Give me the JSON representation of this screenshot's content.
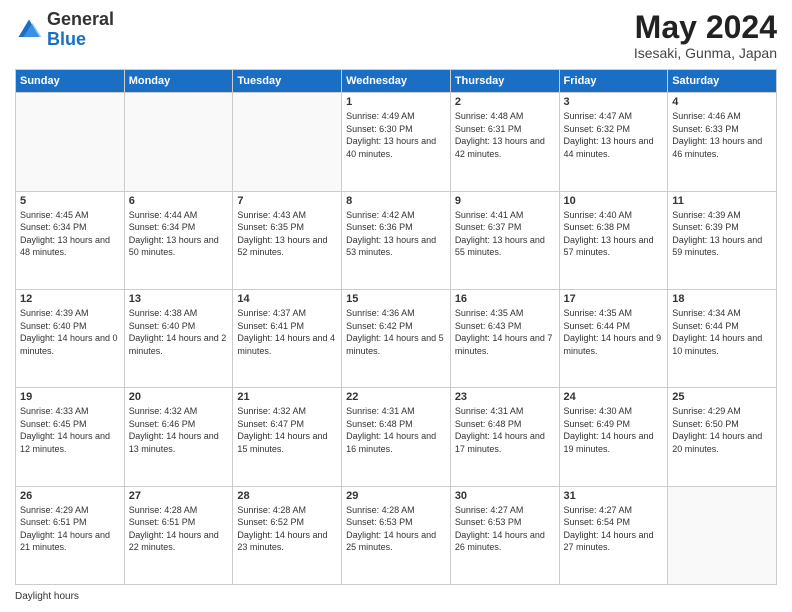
{
  "header": {
    "logo_general": "General",
    "logo_blue": "Blue",
    "month_title": "May 2024",
    "location": "Isesaki, Gunma, Japan"
  },
  "days_of_week": [
    "Sunday",
    "Monday",
    "Tuesday",
    "Wednesday",
    "Thursday",
    "Friday",
    "Saturday"
  ],
  "weeks": [
    [
      {
        "day": "",
        "sunrise": "",
        "sunset": "",
        "daylight": ""
      },
      {
        "day": "",
        "sunrise": "",
        "sunset": "",
        "daylight": ""
      },
      {
        "day": "",
        "sunrise": "",
        "sunset": "",
        "daylight": ""
      },
      {
        "day": "1",
        "sunrise": "Sunrise: 4:49 AM",
        "sunset": "Sunset: 6:30 PM",
        "daylight": "Daylight: 13 hours and 40 minutes."
      },
      {
        "day": "2",
        "sunrise": "Sunrise: 4:48 AM",
        "sunset": "Sunset: 6:31 PM",
        "daylight": "Daylight: 13 hours and 42 minutes."
      },
      {
        "day": "3",
        "sunrise": "Sunrise: 4:47 AM",
        "sunset": "Sunset: 6:32 PM",
        "daylight": "Daylight: 13 hours and 44 minutes."
      },
      {
        "day": "4",
        "sunrise": "Sunrise: 4:46 AM",
        "sunset": "Sunset: 6:33 PM",
        "daylight": "Daylight: 13 hours and 46 minutes."
      }
    ],
    [
      {
        "day": "5",
        "sunrise": "Sunrise: 4:45 AM",
        "sunset": "Sunset: 6:34 PM",
        "daylight": "Daylight: 13 hours and 48 minutes."
      },
      {
        "day": "6",
        "sunrise": "Sunrise: 4:44 AM",
        "sunset": "Sunset: 6:34 PM",
        "daylight": "Daylight: 13 hours and 50 minutes."
      },
      {
        "day": "7",
        "sunrise": "Sunrise: 4:43 AM",
        "sunset": "Sunset: 6:35 PM",
        "daylight": "Daylight: 13 hours and 52 minutes."
      },
      {
        "day": "8",
        "sunrise": "Sunrise: 4:42 AM",
        "sunset": "Sunset: 6:36 PM",
        "daylight": "Daylight: 13 hours and 53 minutes."
      },
      {
        "day": "9",
        "sunrise": "Sunrise: 4:41 AM",
        "sunset": "Sunset: 6:37 PM",
        "daylight": "Daylight: 13 hours and 55 minutes."
      },
      {
        "day": "10",
        "sunrise": "Sunrise: 4:40 AM",
        "sunset": "Sunset: 6:38 PM",
        "daylight": "Daylight: 13 hours and 57 minutes."
      },
      {
        "day": "11",
        "sunrise": "Sunrise: 4:39 AM",
        "sunset": "Sunset: 6:39 PM",
        "daylight": "Daylight: 13 hours and 59 minutes."
      }
    ],
    [
      {
        "day": "12",
        "sunrise": "Sunrise: 4:39 AM",
        "sunset": "Sunset: 6:40 PM",
        "daylight": "Daylight: 14 hours and 0 minutes."
      },
      {
        "day": "13",
        "sunrise": "Sunrise: 4:38 AM",
        "sunset": "Sunset: 6:40 PM",
        "daylight": "Daylight: 14 hours and 2 minutes."
      },
      {
        "day": "14",
        "sunrise": "Sunrise: 4:37 AM",
        "sunset": "Sunset: 6:41 PM",
        "daylight": "Daylight: 14 hours and 4 minutes."
      },
      {
        "day": "15",
        "sunrise": "Sunrise: 4:36 AM",
        "sunset": "Sunset: 6:42 PM",
        "daylight": "Daylight: 14 hours and 5 minutes."
      },
      {
        "day": "16",
        "sunrise": "Sunrise: 4:35 AM",
        "sunset": "Sunset: 6:43 PM",
        "daylight": "Daylight: 14 hours and 7 minutes."
      },
      {
        "day": "17",
        "sunrise": "Sunrise: 4:35 AM",
        "sunset": "Sunset: 6:44 PM",
        "daylight": "Daylight: 14 hours and 9 minutes."
      },
      {
        "day": "18",
        "sunrise": "Sunrise: 4:34 AM",
        "sunset": "Sunset: 6:44 PM",
        "daylight": "Daylight: 14 hours and 10 minutes."
      }
    ],
    [
      {
        "day": "19",
        "sunrise": "Sunrise: 4:33 AM",
        "sunset": "Sunset: 6:45 PM",
        "daylight": "Daylight: 14 hours and 12 minutes."
      },
      {
        "day": "20",
        "sunrise": "Sunrise: 4:32 AM",
        "sunset": "Sunset: 6:46 PM",
        "daylight": "Daylight: 14 hours and 13 minutes."
      },
      {
        "day": "21",
        "sunrise": "Sunrise: 4:32 AM",
        "sunset": "Sunset: 6:47 PM",
        "daylight": "Daylight: 14 hours and 15 minutes."
      },
      {
        "day": "22",
        "sunrise": "Sunrise: 4:31 AM",
        "sunset": "Sunset: 6:48 PM",
        "daylight": "Daylight: 14 hours and 16 minutes."
      },
      {
        "day": "23",
        "sunrise": "Sunrise: 4:31 AM",
        "sunset": "Sunset: 6:48 PM",
        "daylight": "Daylight: 14 hours and 17 minutes."
      },
      {
        "day": "24",
        "sunrise": "Sunrise: 4:30 AM",
        "sunset": "Sunset: 6:49 PM",
        "daylight": "Daylight: 14 hours and 19 minutes."
      },
      {
        "day": "25",
        "sunrise": "Sunrise: 4:29 AM",
        "sunset": "Sunset: 6:50 PM",
        "daylight": "Daylight: 14 hours and 20 minutes."
      }
    ],
    [
      {
        "day": "26",
        "sunrise": "Sunrise: 4:29 AM",
        "sunset": "Sunset: 6:51 PM",
        "daylight": "Daylight: 14 hours and 21 minutes."
      },
      {
        "day": "27",
        "sunrise": "Sunrise: 4:28 AM",
        "sunset": "Sunset: 6:51 PM",
        "daylight": "Daylight: 14 hours and 22 minutes."
      },
      {
        "day": "28",
        "sunrise": "Sunrise: 4:28 AM",
        "sunset": "Sunset: 6:52 PM",
        "daylight": "Daylight: 14 hours and 23 minutes."
      },
      {
        "day": "29",
        "sunrise": "Sunrise: 4:28 AM",
        "sunset": "Sunset: 6:53 PM",
        "daylight": "Daylight: 14 hours and 25 minutes."
      },
      {
        "day": "30",
        "sunrise": "Sunrise: 4:27 AM",
        "sunset": "Sunset: 6:53 PM",
        "daylight": "Daylight: 14 hours and 26 minutes."
      },
      {
        "day": "31",
        "sunrise": "Sunrise: 4:27 AM",
        "sunset": "Sunset: 6:54 PM",
        "daylight": "Daylight: 14 hours and 27 minutes."
      },
      {
        "day": "",
        "sunrise": "",
        "sunset": "",
        "daylight": ""
      }
    ]
  ],
  "footer": {
    "daylight_label": "Daylight hours"
  }
}
